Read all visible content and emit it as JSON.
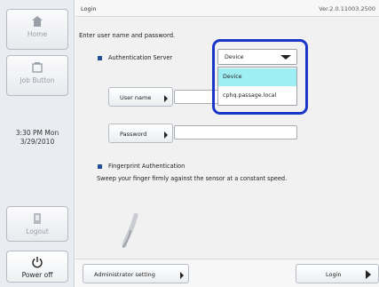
{
  "sidebar": {
    "home_label": "Home",
    "job_label": "Job Button",
    "clock_time": "3:30 PM  Mon",
    "clock_date": "3/29/2010",
    "logout_label": "Logout",
    "power_label": "Power off"
  },
  "header": {
    "title": "Login",
    "version": "Ver.2.0.11003.2500"
  },
  "main": {
    "instruction": "Enter user name and password.",
    "auth_server_label": "Authentication Server",
    "user_name_button": "User name",
    "user_name_value": "",
    "password_button": "Password",
    "password_value": "",
    "fingerprint_label": "Fingerprint Authentication",
    "sweep_instruction": "Sweep your finger firmly against the sensor at a constant speed."
  },
  "dropdown": {
    "selected": "Device",
    "options": [
      "Device",
      "cphq.passage.local"
    ]
  },
  "footer": {
    "admin_button": "Administrator setting",
    "login_button": "Login"
  },
  "colors": {
    "highlight_outline": "#1a36c9",
    "selected_option": "#9eeef4",
    "bullet": "#24509a"
  }
}
